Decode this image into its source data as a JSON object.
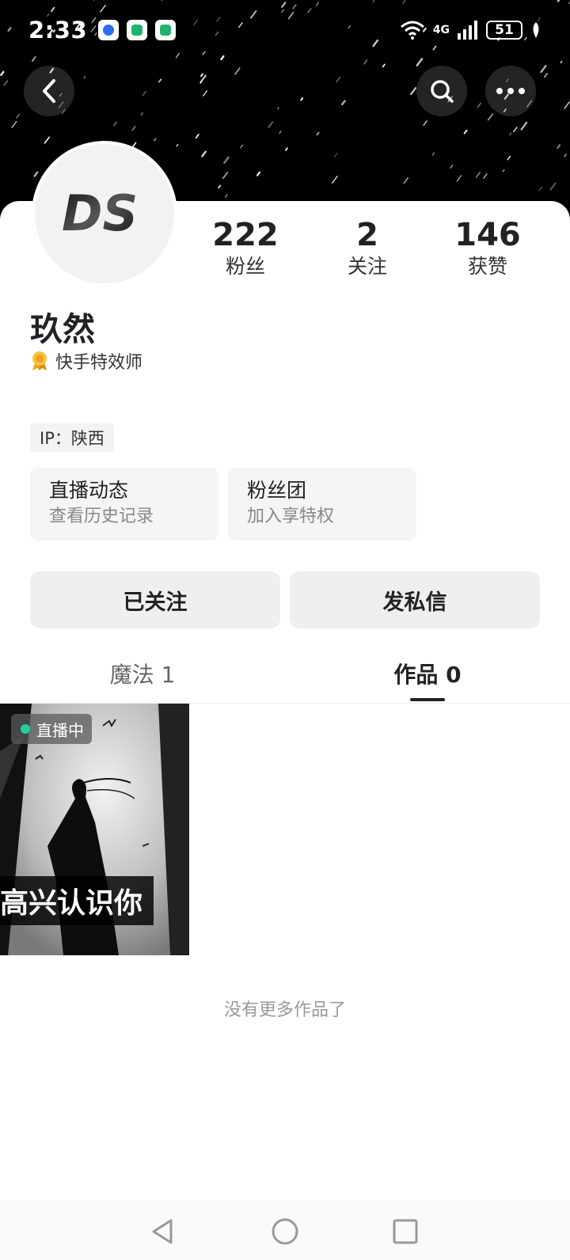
{
  "status_bar": {
    "time": "2:33",
    "network": "4G",
    "battery": "51"
  },
  "profile": {
    "avatar_logo_text": "DS",
    "name": "玖然",
    "badge_text": "快手特效师",
    "ip_label": "IP：陕西"
  },
  "stats": [
    {
      "value": "222",
      "label": "粉丝"
    },
    {
      "value": "2",
      "label": "关注"
    },
    {
      "value": "146",
      "label": "获赞"
    }
  ],
  "cards": [
    {
      "title": "直播动态",
      "subtitle": "查看历史记录"
    },
    {
      "title": "粉丝团",
      "subtitle": "加入享特权"
    }
  ],
  "actions": {
    "followed": "已关注",
    "message": "发私信"
  },
  "tabs": [
    {
      "label": "魔法 1",
      "active": false
    },
    {
      "label": "作品 0",
      "active": true
    }
  ],
  "works": [
    {
      "badge": "直播中",
      "caption": "高兴认识你"
    }
  ],
  "empty_text": "没有更多作品了",
  "colors": {
    "accent_live": "#1ed0a0",
    "text_primary": "#222222",
    "text_secondary": "#888888"
  },
  "icons": {
    "back": "back-icon",
    "search": "search-icon",
    "more": "more-icon",
    "badge": "medal-icon"
  }
}
